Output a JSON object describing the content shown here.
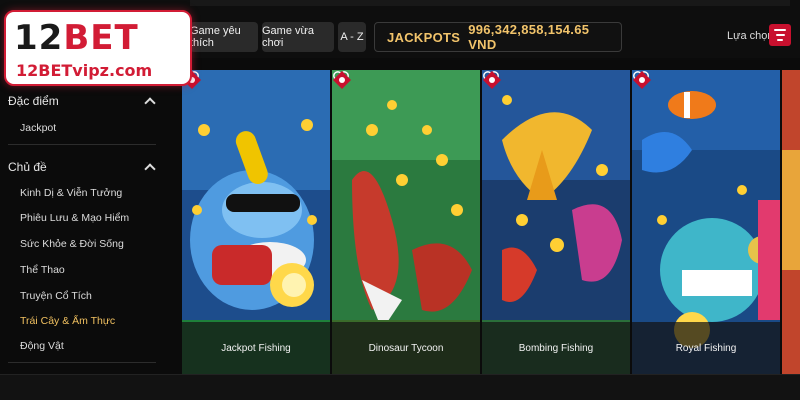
{
  "header": {
    "filters": [
      {
        "label": "Game yêu thích"
      },
      {
        "label": "Game vừa chơi"
      },
      {
        "label": "A - Z"
      }
    ],
    "jackpot": {
      "label": "JACKPOTS",
      "value": "996,342,858,154.65 VND"
    },
    "sort_label": "Lựa chọn"
  },
  "logo": {
    "main_num": "12",
    "main_bet": "BET",
    "sub": "12BETvipz.com"
  },
  "sidebar": {
    "sections": [
      {
        "title": "Đặc điểm",
        "items": [
          "Jackpot"
        ]
      },
      {
        "title": "Chủ đề",
        "items": [
          "Kinh Dị & Viễn Tưởng",
          "Phiêu Lưu & Mạo Hiểm",
          "Sức Khỏe & Đời Sống",
          "Thể Thao",
          "Truyện Cổ Tích",
          "Trái Cây & Ẩm Thực",
          "Động Vật"
        ]
      }
    ],
    "active_item": "Trái Cây & Ẩm Thực"
  },
  "games": [
    {
      "name": "Jackpot Fishing",
      "icon": "shark-icon"
    },
    {
      "name": "Dinosaur Tycoon",
      "icon": "dinosaur-icon"
    },
    {
      "name": "Bombing Fishing",
      "icon": "manta-ray-icon"
    },
    {
      "name": "Royal Fishing",
      "icon": "clownfish-icon"
    }
  ],
  "colors": {
    "brand_red": "#d21c35",
    "gold": "#f2c46b",
    "bg": "#0b0b0b"
  }
}
